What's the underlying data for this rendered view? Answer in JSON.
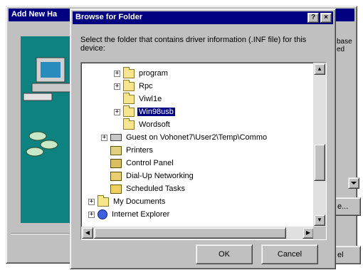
{
  "wizard": {
    "title": "Add New Ha",
    "side_text_line1": "base",
    "side_text_line2": "ed",
    "button_a_label": "e...",
    "button_b_label": "el"
  },
  "dialog": {
    "title": "Browse for Folder",
    "help_glyph": "?",
    "close_glyph": "×",
    "instructions": "Select the folder that contains driver information (.INF file) for this device:",
    "ok_label": "OK",
    "cancel_label": "Cancel"
  },
  "tree": {
    "items": [
      {
        "label": "program",
        "icon": "folder-icon",
        "expander": "+",
        "indent": 3,
        "selected": false
      },
      {
        "label": "Rpc",
        "icon": "folder-icon",
        "expander": "+",
        "indent": 3,
        "selected": false
      },
      {
        "label": "Viwl1e",
        "icon": "folder-icon",
        "expander": "",
        "indent": 3,
        "selected": false
      },
      {
        "label": "Win98usb",
        "icon": "folder-icon",
        "expander": "+",
        "indent": 3,
        "selected": true
      },
      {
        "label": "Wordsoft",
        "icon": "folder-icon",
        "expander": "",
        "indent": 3,
        "selected": false
      },
      {
        "label": "Guest on Vohonet7\\User2\\Temp\\Commo",
        "icon": "network-drive-icon",
        "expander": "+",
        "indent": 2,
        "selected": false
      },
      {
        "label": "Printers",
        "icon": "printers-icon",
        "expander": "",
        "indent": 2,
        "selected": false
      },
      {
        "label": "Control Panel",
        "icon": "control-panel-icon",
        "expander": "",
        "indent": 2,
        "selected": false
      },
      {
        "label": "Dial-Up Networking",
        "icon": "dialup-networking-icon",
        "expander": "",
        "indent": 2,
        "selected": false
      },
      {
        "label": "Scheduled Tasks",
        "icon": "scheduled-tasks-icon",
        "expander": "",
        "indent": 2,
        "selected": false
      },
      {
        "label": "My Documents",
        "icon": "folder-icon",
        "expander": "+",
        "indent": 1,
        "selected": false
      },
      {
        "label": "Internet Explorer",
        "icon": "internet-explorer-icon",
        "expander": "+",
        "indent": 1,
        "selected": false
      }
    ]
  },
  "scrollbars": {
    "up_glyph": "▲",
    "down_glyph": "▼",
    "left_glyph": "◀",
    "right_glyph": "▶"
  }
}
